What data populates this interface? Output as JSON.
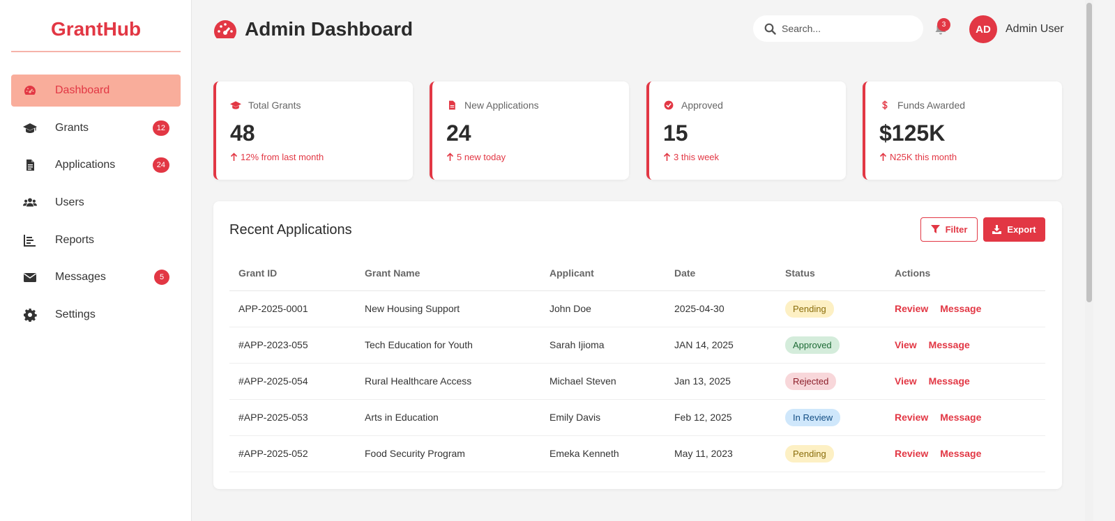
{
  "brand": "GrantHub",
  "sidebar": {
    "items": [
      {
        "label": "Dashboard",
        "icon": "gauge-icon",
        "badge": ""
      },
      {
        "label": "Grants",
        "icon": "graduation-cap-icon",
        "badge": "12"
      },
      {
        "label": "Applications",
        "icon": "document-icon",
        "badge": "24"
      },
      {
        "label": "Users",
        "icon": "users-icon",
        "badge": ""
      },
      {
        "label": "Reports",
        "icon": "chart-icon",
        "badge": ""
      },
      {
        "label": "Messages",
        "icon": "envelope-icon",
        "badge": "5"
      },
      {
        "label": "Settings",
        "icon": "gear-icon",
        "badge": ""
      }
    ]
  },
  "header": {
    "title": "Admin Dashboard",
    "search_placeholder": "Search...",
    "notification_count": "3",
    "avatar_initials": "AD",
    "user_name": "Admin User"
  },
  "stats": [
    {
      "label": "Total Grants",
      "icon": "graduation-cap-icon",
      "value": "48",
      "note": "12% from last month"
    },
    {
      "label": "New Applications",
      "icon": "document-icon",
      "value": "24",
      "note": "5 new today"
    },
    {
      "label": "Approved",
      "icon": "check-circle-icon",
      "value": "15",
      "note": "3 this week"
    },
    {
      "label": "Funds Awarded",
      "icon": "dollar-icon",
      "value": "$125K",
      "note": "N25K this month"
    }
  ],
  "recent": {
    "title": "Recent Applications",
    "filter_label": "Filter",
    "export_label": "Export",
    "columns": [
      "Grant ID",
      "Grant Name",
      "Applicant",
      "Date",
      "Status",
      "Actions"
    ],
    "rows": [
      {
        "id": "APP-2025-0001",
        "name": "New Housing Support",
        "applicant": "John Doe",
        "date": "2025-04-30",
        "status": "Pending",
        "action1": "Review",
        "action2": "Message"
      },
      {
        "id": "#APP-2023-055",
        "name": "Tech Education for Youth",
        "applicant": "Sarah Ijioma",
        "date": "JAN 14, 2025",
        "status": "Approved",
        "action1": "View",
        "action2": "Message"
      },
      {
        "id": "#APP-2025-054",
        "name": "Rural Healthcare Access",
        "applicant": "Michael Steven",
        "date": "Jan 13, 2025",
        "status": "Rejected",
        "action1": "View",
        "action2": "Message"
      },
      {
        "id": "#APP-2025-053",
        "name": "Arts in Education",
        "applicant": "Emily Davis",
        "date": "Feb 12, 2025",
        "status": "In Review",
        "action1": "Review",
        "action2": "Message"
      },
      {
        "id": "#APP-2025-052",
        "name": "Food Security Program",
        "applicant": "Emeka Kenneth",
        "date": "May 11, 2023",
        "status": "Pending",
        "action1": "Review",
        "action2": "Message"
      }
    ]
  },
  "colors": {
    "accent": "#e23744",
    "active_nav": "#f9ad9b"
  }
}
